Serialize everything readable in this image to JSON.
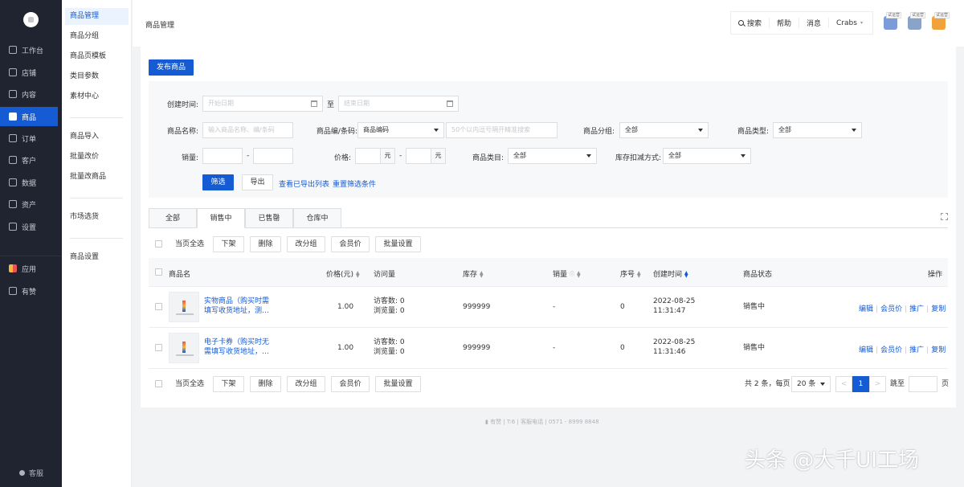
{
  "sidebar": {
    "items": [
      {
        "label": "工作台",
        "icon": "chat-icon"
      },
      {
        "label": "店铺",
        "icon": "store-icon"
      },
      {
        "label": "内容",
        "icon": "image-icon"
      },
      {
        "label": "商品",
        "icon": "bag-icon",
        "active": true
      },
      {
        "label": "订单",
        "icon": "order-icon"
      },
      {
        "label": "客户",
        "icon": "user-icon"
      },
      {
        "label": "数据",
        "icon": "chart-icon"
      },
      {
        "label": "资产",
        "icon": "yen-icon"
      },
      {
        "label": "设置",
        "icon": "gear-icon"
      }
    ],
    "apps_label": "应用",
    "youzan_label": "有赞",
    "kefu_label": "客服"
  },
  "submenu": {
    "group1": [
      "商品管理",
      "商品分组",
      "商品页模板",
      "类目参数",
      "素材中心"
    ],
    "group2": [
      "商品导入",
      "批量改价",
      "批量改商品"
    ],
    "group3": [
      "市场选货"
    ],
    "group4": [
      "商品设置"
    ]
  },
  "header": {
    "title": "商品管理",
    "search": "搜索",
    "help": "帮助",
    "messages": "消息",
    "user": "Crabs",
    "app_tag": "试运营",
    "app_colors": [
      "#7b9cd8",
      "#8aa3c8",
      "#f0a33c"
    ]
  },
  "toolbar": {
    "publish_label": "发布商品"
  },
  "filter": {
    "created_label": "创建时间:",
    "start_placeholder": "开始日期",
    "to_label": "至",
    "end_placeholder": "结束日期",
    "name_label": "商品名称:",
    "name_placeholder": "输入商品名称、编/条码",
    "code_label": "商品编/条码:",
    "code_type_value": "商品编码",
    "code_placeholder": "50个以内逗号隔开精准搜索",
    "group_label": "商品分组:",
    "group_value": "全部",
    "type_label": "商品类型:",
    "type_value": "全部",
    "sales_label": "销量:",
    "dash": "-",
    "price_label": "价格:",
    "yuan": "元",
    "category_label": "商品类目:",
    "category_value": "全部",
    "stock_label": "库存扣减方式:",
    "stock_value": "全部",
    "filter_button": "筛选",
    "export_button": "导出",
    "view_exports_link": "查看已导出列表",
    "reset_link": "重置筛选条件"
  },
  "tabs": [
    "全部",
    "销售中",
    "已售罄",
    "仓库中"
  ],
  "bulk": {
    "select_all": "当页全选",
    "actions": [
      "下架",
      "删除",
      "改分组",
      "会员价",
      "批量设置"
    ]
  },
  "table": {
    "headers": {
      "name": "商品名",
      "price": "价格(元)",
      "visits": "访问量",
      "stock": "库存",
      "sales": "销量",
      "seq": "序号",
      "created": "创建时间",
      "status": "商品状态",
      "ops": "操作"
    },
    "rows": [
      {
        "name": "实物商品（购买时需填写收货地址，测…",
        "price": "1.00",
        "visitors": "访客数: 0",
        "views": "浏览量: 0",
        "stock": "999999",
        "sales": "-",
        "seq": "0",
        "date": "2022-08-25",
        "time": "11:31:47",
        "status": "销售中"
      },
      {
        "name": "电子卡券（购买时无需填写收货地址，…",
        "price": "1.00",
        "visitors": "访客数: 0",
        "views": "浏览量: 0",
        "stock": "999999",
        "sales": "-",
        "seq": "0",
        "date": "2022-08-25",
        "time": "11:31:46",
        "status": "销售中"
      }
    ],
    "ops": [
      "编辑",
      "会员价",
      "推广",
      "复制"
    ]
  },
  "pager": {
    "total": "共 2 条，每页",
    "per_page": "20 条",
    "prev": "<",
    "current": "1",
    "next": ">",
    "jump": "跳至",
    "page_unit": "页"
  },
  "footer": {
    "brand": "有赞",
    "sep": "|",
    "code": "T:6",
    "hotline": "客服电话 | 0571 - 8999 8848"
  },
  "watermark": "头条 @大千UI工场",
  "colors": {
    "accent": "#155bd4",
    "sidebar": "#1f2430"
  }
}
